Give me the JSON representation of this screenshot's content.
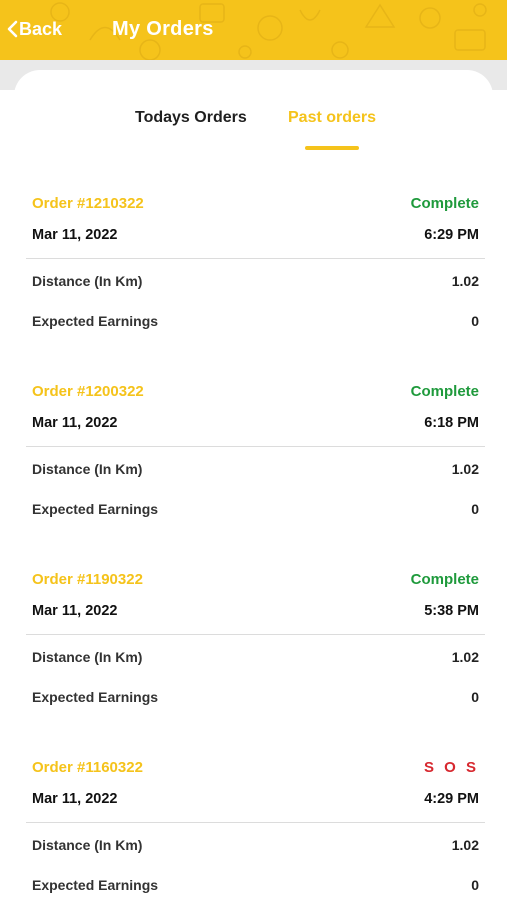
{
  "header": {
    "back_label": "Back",
    "title": "My Orders",
    "color": "#f5c31b"
  },
  "tabs": [
    {
      "label": "Todays Orders",
      "active": false
    },
    {
      "label": "Past orders",
      "active": true
    }
  ],
  "orders": [
    {
      "id": "Order #1210322",
      "status": "Complete",
      "status_color": "#1f9a3c",
      "date": "Mar 11, 2022",
      "time": "6:29 PM",
      "distance_label": "Distance (In Km)",
      "distance": "1.02",
      "earnings_label": "Expected Earnings",
      "earnings": "0"
    },
    {
      "id": "Order #1200322",
      "status": "Complete",
      "status_color": "#1f9a3c",
      "date": "Mar 11, 2022",
      "time": "6:18 PM",
      "distance_label": "Distance (In Km)",
      "distance": "1.02",
      "earnings_label": "Expected Earnings",
      "earnings": "0"
    },
    {
      "id": "Order #1190322",
      "status": "Complete",
      "status_color": "#1f9a3c",
      "date": "Mar 11, 2022",
      "time": "5:38 PM",
      "distance_label": "Distance (In Km)",
      "distance": "1.02",
      "earnings_label": "Expected Earnings",
      "earnings": "0"
    },
    {
      "id": "Order #1160322",
      "status": "S O S",
      "status_color": "#d7282f",
      "date": "Mar 11, 2022",
      "time": "4:29 PM",
      "distance_label": "Distance (In Km)",
      "distance": "1.02",
      "earnings_label": "Expected Earnings",
      "earnings": "0"
    }
  ]
}
